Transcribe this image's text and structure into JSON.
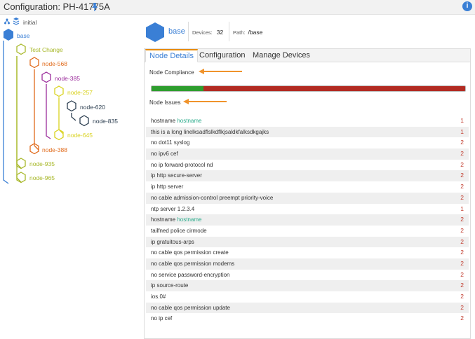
{
  "title": "Configuration: PH-41775A",
  "colors": {
    "accent": "#3a7fd5",
    "orange": "#e68a00",
    "green": "#2e9e2e",
    "red": "#b22b22",
    "teal": "#2aab8b"
  },
  "tree": {
    "initial_label": "initial",
    "nodes": [
      {
        "label": "base",
        "color": "#3a7fd5"
      },
      {
        "label": "Test Change",
        "color": "#a8b82a"
      },
      {
        "label": "node-568",
        "color": "#e06a1b"
      },
      {
        "label": "node-385",
        "color": "#9b2c9b"
      },
      {
        "label": "node-257",
        "color": "#d9d21e"
      },
      {
        "label": "node-620",
        "color": "#2c3e50"
      },
      {
        "label": "node-835",
        "color": "#2c3e50"
      },
      {
        "label": "node-645",
        "color": "#d9d21e"
      },
      {
        "label": "node-388",
        "color": "#e06a1b"
      },
      {
        "label": "node-935",
        "color": "#a8b82a"
      },
      {
        "label": "node-965",
        "color": "#a8b82a"
      }
    ]
  },
  "header": {
    "name": "base",
    "devices_label": "Devices:",
    "devices_count": "32",
    "path_label": "Path:",
    "path_value": "/base"
  },
  "tabs": [
    "Node Details",
    "Configuration",
    "Manage Devices"
  ],
  "compliance": {
    "label": "Node Compliance",
    "fraction_compliant": 0.165
  },
  "issues_label": "Node Issues",
  "issues": [
    {
      "text": "hostname ",
      "highlight": "hostname",
      "count": "1"
    },
    {
      "text": "this is a long linelksadflslkdflkjsaldkfalksdkgajks",
      "highlight": "",
      "count": "1"
    },
    {
      "text": "no dot11 syslog",
      "highlight": "",
      "count": "2"
    },
    {
      "text": "no ipv6 cef",
      "highlight": "",
      "count": "2"
    },
    {
      "text": "no ip forward-protocol nd",
      "highlight": "",
      "count": "2"
    },
    {
      "text": "ip http secure-server",
      "highlight": "",
      "count": "2"
    },
    {
      "text": "ip http server",
      "highlight": "",
      "count": "2"
    },
    {
      "text": "no cable admission-control preempt priority-voice",
      "highlight": "",
      "count": "2"
    },
    {
      "text": "ntp server 1.2.3.4",
      "highlight": "",
      "count": "1"
    },
    {
      "text": "hostname ",
      "highlight": "hostname",
      "count": "2"
    },
    {
      "text": "tailfned police cirmode",
      "highlight": "",
      "count": "2"
    },
    {
      "text": "ip gratuitous-arps",
      "highlight": "",
      "count": "2"
    },
    {
      "text": "no cable qos permission create",
      "highlight": "",
      "count": "2"
    },
    {
      "text": "no cable qos permission modems",
      "highlight": "",
      "count": "2"
    },
    {
      "text": "no service password-encryption",
      "highlight": "",
      "count": "2"
    },
    {
      "text": "ip source-route",
      "highlight": "",
      "count": "2"
    },
    {
      "text": "ios.0#",
      "highlight": "",
      "count": "2"
    },
    {
      "text": "no cable qos permission update",
      "highlight": "",
      "count": "2"
    },
    {
      "text": "no ip cef",
      "highlight": "",
      "count": "2"
    }
  ]
}
